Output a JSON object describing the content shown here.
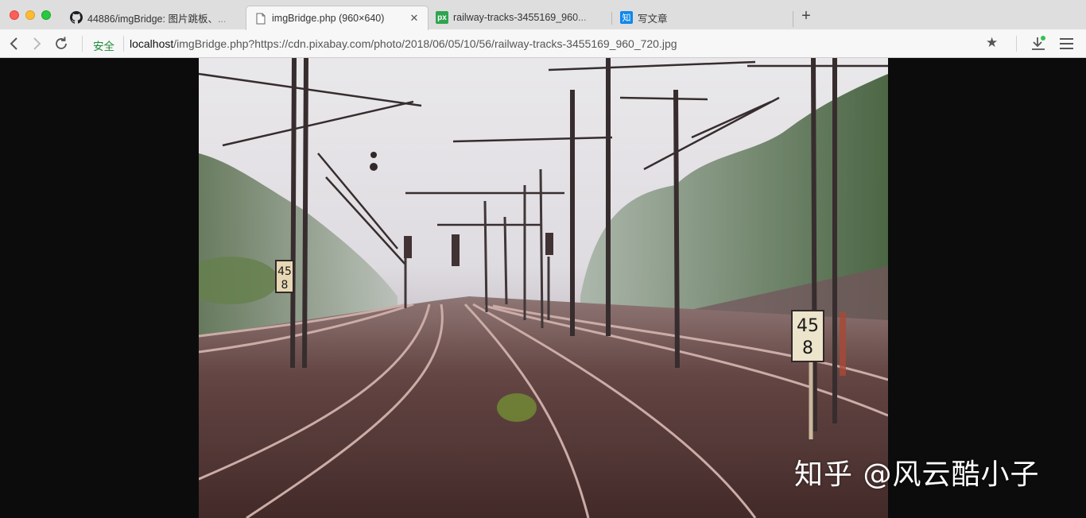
{
  "window": {
    "tabs": [
      {
        "title": "44886/imgBridge: 图片跳板、...",
        "icon": "github-icon",
        "active": false
      },
      {
        "title": "imgBridge.php (960×640)",
        "icon": "page-icon",
        "active": true
      },
      {
        "title": "railway-tracks-3455169_960...",
        "icon": "pixabay-icon",
        "icon_text": "px",
        "active": false
      },
      {
        "title": "写文章",
        "icon": "zhihu-icon",
        "icon_text": "知",
        "active": false
      }
    ],
    "new_tab_label": "+"
  },
  "toolbar": {
    "security_label": "安全",
    "url_host": "localhost",
    "url_rest": "/imgBridge.php?https://cdn.pixabay.com/photo/2018/06/05/10/56/railway-tracks-3455169_960_720.jpg"
  },
  "content": {
    "image_alt": "railway tracks",
    "sign_left": [
      "45",
      "8"
    ],
    "sign_right": [
      "45",
      "8"
    ],
    "watermark": "知乎 @风云酷小子"
  },
  "colors": {
    "secure": "#1e8a39",
    "pixabay": "#2ea44f",
    "zhihu": "#0f88eb"
  }
}
